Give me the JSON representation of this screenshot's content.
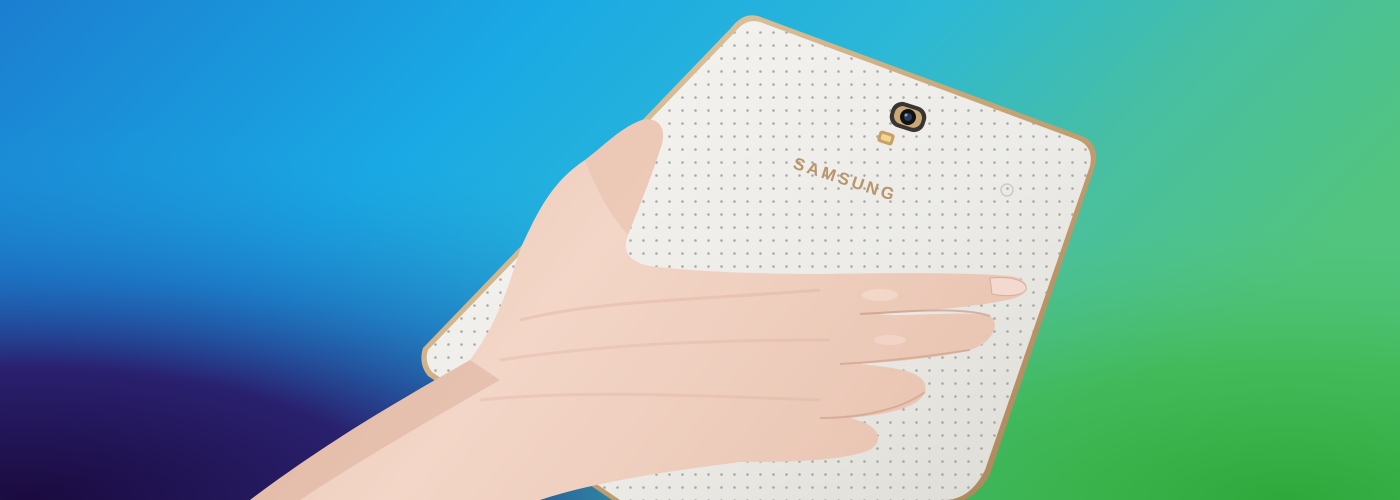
{
  "banner": {
    "device_brand": "SAMSUNG",
    "colors": {
      "bg_top_left": "#1a8fd6",
      "bg_mid": "#18b0e6",
      "bg_bottom_left": "#2a0f5e",
      "bg_right": "#4cc08a",
      "bg_bottom_right": "#3aae3c",
      "device_shell": "#f2f0ec",
      "device_edge": "#c8a574",
      "skin": "#f0d2c3",
      "skin_shadow": "#c99a86"
    }
  }
}
